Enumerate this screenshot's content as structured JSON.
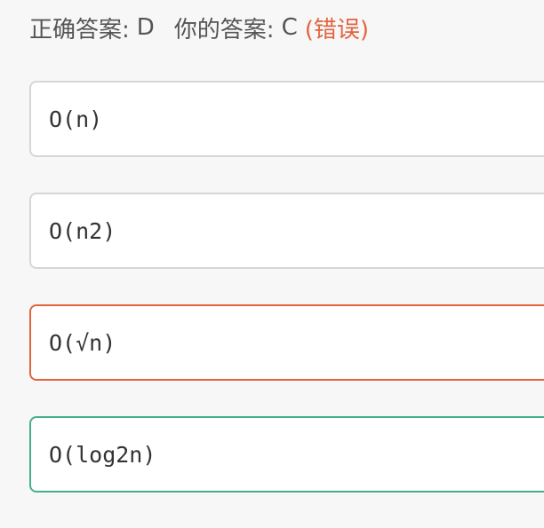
{
  "result": {
    "correct_label": "正确答案:",
    "correct_value": "D",
    "your_label": "你的答案:",
    "your_value": "C",
    "status": "(错误)"
  },
  "colors": {
    "wrong": "#e2643f",
    "correct": "#44b08a",
    "neutral_border": "#d6d6d6"
  },
  "options": [
    {
      "text": "O(n)",
      "state": "neutral"
    },
    {
      "text": "O(n2)",
      "state": "neutral"
    },
    {
      "text": "O(√n)",
      "state": "wrong"
    },
    {
      "text": "O(log2n)",
      "state": "correct"
    }
  ]
}
